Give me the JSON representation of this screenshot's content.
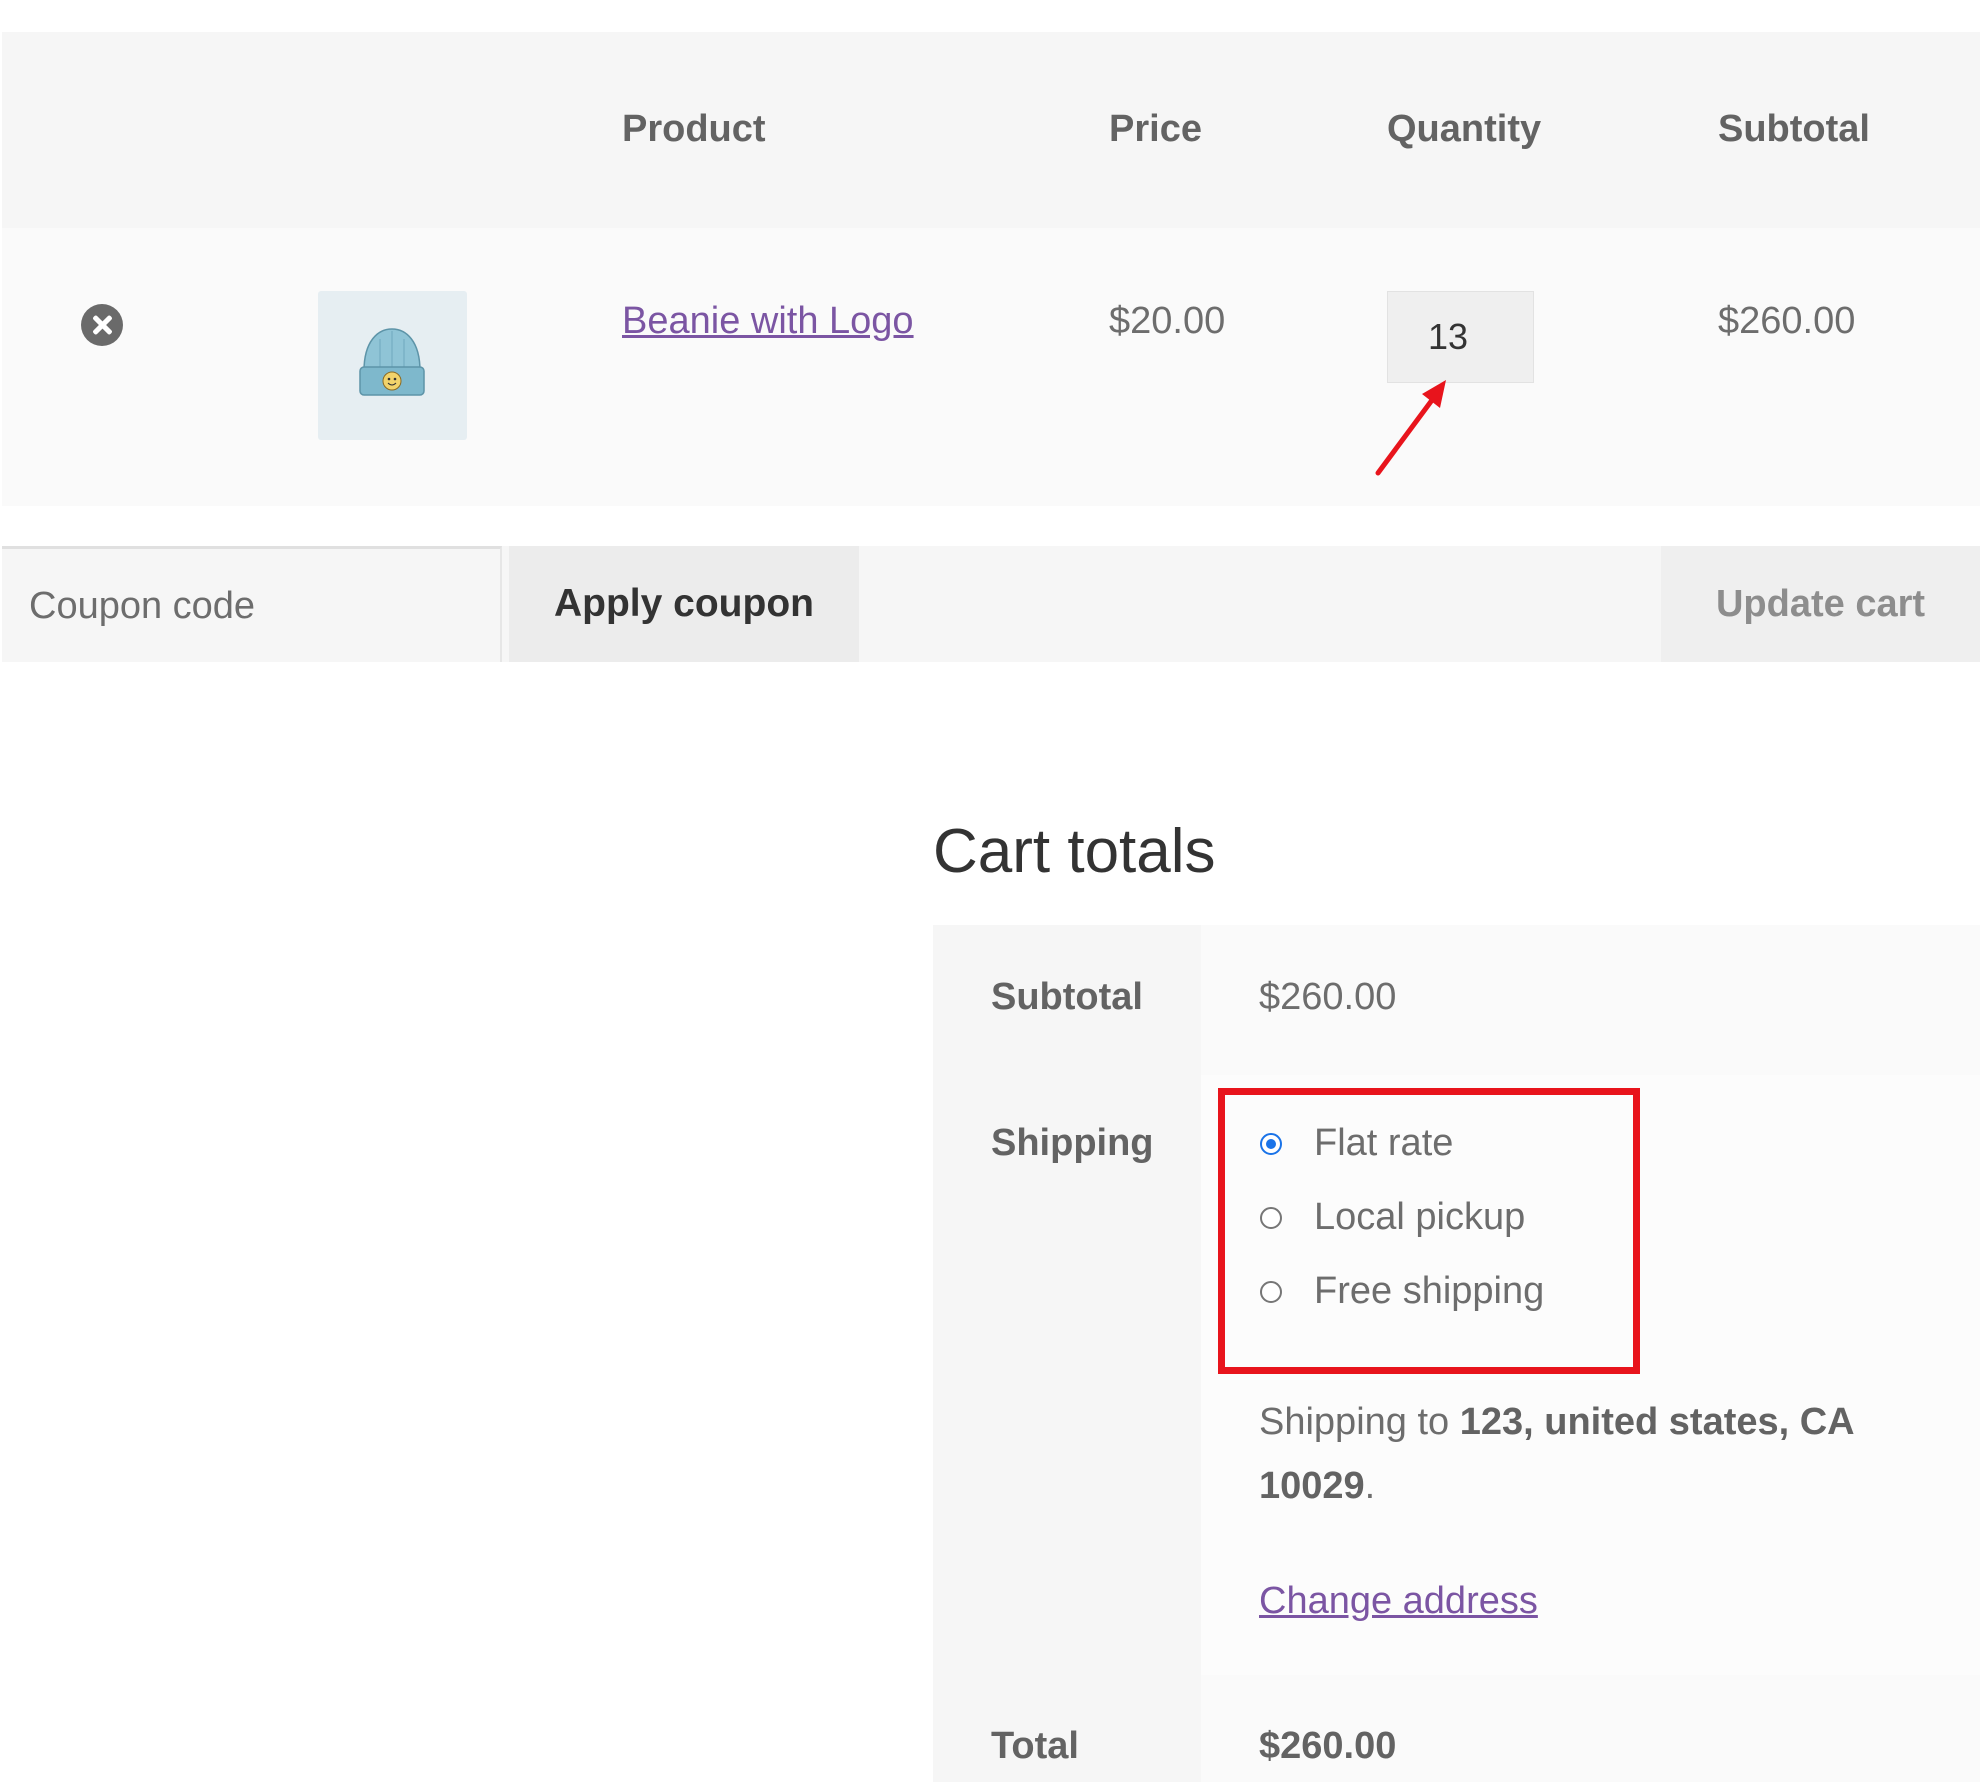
{
  "cart": {
    "headers": {
      "product": "Product",
      "price": "Price",
      "quantity": "Quantity",
      "subtotal": "Subtotal"
    },
    "item": {
      "remove_icon": "close-circle-icon",
      "thumbnail_icon": "beanie-product-icon",
      "name": "Beanie with Logo",
      "price": "$20.00",
      "quantity": "13",
      "subtotal": "$260.00"
    },
    "coupon_placeholder": "Coupon code",
    "apply_coupon": "Apply coupon",
    "update_cart": "Update cart"
  },
  "totals": {
    "title": "Cart totals",
    "subtotal_label": "Subtotal",
    "subtotal_value": "$260.00",
    "shipping_label": "Shipping",
    "shipping_options": [
      {
        "label": "Flat rate",
        "selected": true
      },
      {
        "label": "Local pickup",
        "selected": false
      },
      {
        "label": "Free shipping",
        "selected": false
      }
    ],
    "shipping_to_prefix": "Shipping to ",
    "shipping_address": "123, united states, CA 10029",
    "shipping_to_suffix": ".",
    "change_address": "Change address",
    "total_label": "Total",
    "total_value": "$260.00"
  },
  "annotations": {
    "highlight_color": "#e8141c",
    "arrow_color": "#e8141c",
    "accent_link_color": "#7b55a3",
    "radio_selected_color": "#1a73e8"
  }
}
